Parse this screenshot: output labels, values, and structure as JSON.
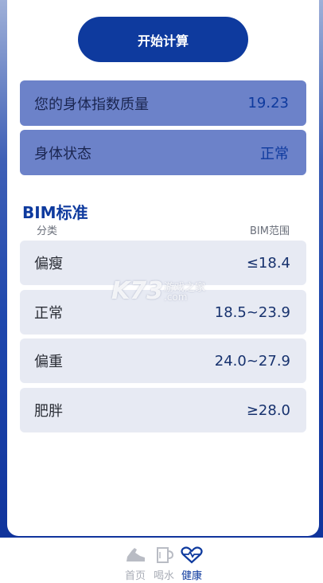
{
  "start_button": {
    "label": "开始计算"
  },
  "results": [
    {
      "label": "您的身体指数质量",
      "value": "19.23"
    },
    {
      "label": "身体状态",
      "value": "正常"
    }
  ],
  "bim_section": {
    "title": "BIM标准",
    "col_category": "分类",
    "col_range": "BIM范围",
    "rows": [
      {
        "name": "偏瘦",
        "range": "≤18.4"
      },
      {
        "name": "正常",
        "range": "18.5~23.9"
      },
      {
        "name": "偏重",
        "range": "24.0~27.9"
      },
      {
        "name": "肥胖",
        "range": "≥28.0"
      }
    ]
  },
  "watermark": {
    "brand": "K73",
    "tagline": "游戏之家",
    "domain": ".com"
  },
  "tabs": [
    {
      "label": "首页",
      "icon": "shoe-icon",
      "active": false
    },
    {
      "label": "喝水",
      "icon": "cup-icon",
      "active": false
    },
    {
      "label": "健康",
      "icon": "heart-pulse-icon",
      "active": true
    }
  ],
  "colors": {
    "accent": "#0e3a9e",
    "result_bg": "#6c82c9",
    "row_bg": "#e7eaf3",
    "inactive_tab": "#a8acb6"
  }
}
